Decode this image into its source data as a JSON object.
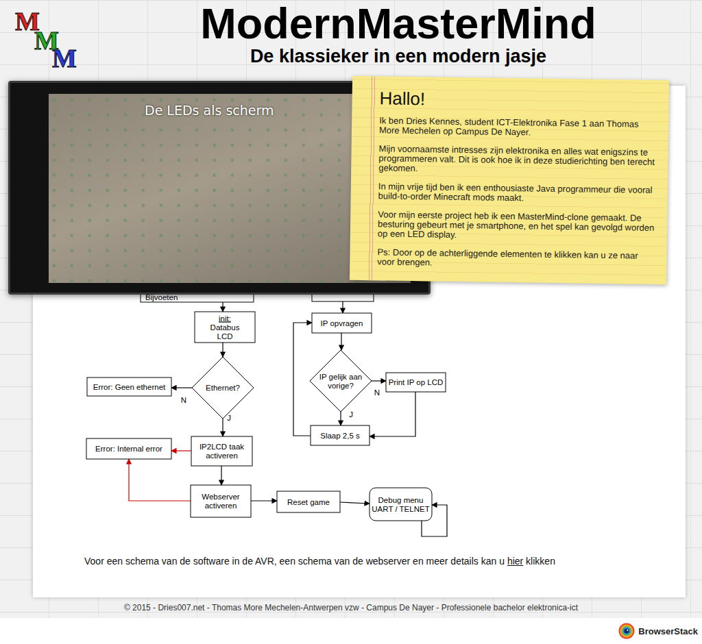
{
  "header": {
    "logo": [
      {
        "text": "M",
        "color": "#e0201c"
      },
      {
        "text": "M",
        "color": "#22b022"
      },
      {
        "text": "M",
        "color": "#2a3ad8"
      }
    ],
    "title": "ModernMasterMind",
    "subtitle": "De klassieker in een modern jasje"
  },
  "slideshow": {
    "caption": "De LEDs als scherm"
  },
  "note": {
    "title": "Hallo!",
    "paragraphs": [
      "Ik ben Dries Kennes, student ICT-Elektronika Fase 1 aan Thomas More Mechelen op Campus De Nayer.",
      "Mijn voornaamste intresses zijn elektronika en alles wat enigszins te programmeren valt. Dit is ook hoe ik in deze studierichting ben terecht gekomen.",
      "In mijn vrije tijd ben ik een enthousiaste Java programmeur die vooral build-to-order Minecraft mods maakt.",
      "Voor mijn eerste project heb ik een MasterMind-clone gemaakt. De besturing gebeurt met je smartphone, en het spel kan gevolgd worden op een LED display.",
      "Ps: Door op de achterliggende elementen te klikken kan u ze naar voor brengen."
    ]
  },
  "flowchart": {
    "nodes": [
      {
        "kind": "box",
        "lines": [
          "Bijvoeten"
        ],
        "underline_first": false
      },
      {
        "kind": "box",
        "lines": [],
        "underline_first": false
      },
      {
        "kind": "box",
        "lines": [
          "init:",
          "Databus",
          "LCD"
        ],
        "underline_first": true
      },
      {
        "kind": "diamond",
        "lines": [
          "Ethernet?"
        ],
        "underline_first": false
      },
      {
        "kind": "box",
        "lines": [
          "Error: Geen ethernet"
        ],
        "underline_first": false
      },
      {
        "kind": "box",
        "lines": [
          "IP2LCD taak",
          "activeren"
        ],
        "underline_first": false
      },
      {
        "kind": "box",
        "lines": [
          "Error: Internal error"
        ],
        "underline_first": false
      },
      {
        "kind": "box",
        "lines": [
          "Webserver",
          "activeren"
        ],
        "underline_first": false
      },
      {
        "kind": "box",
        "lines": [
          "Reset game"
        ],
        "underline_first": false
      },
      {
        "kind": "rounded",
        "lines": [
          "Debug menu",
          "UART / TELNET"
        ],
        "underline_first": false
      },
      {
        "kind": "box",
        "lines": [
          "IP opvragen"
        ],
        "underline_first": false
      },
      {
        "kind": "diamond",
        "lines": [
          "IP gelijk aan",
          "vorige?"
        ],
        "underline_first": false
      },
      {
        "kind": "box",
        "lines": [
          "Print IP op LCD"
        ],
        "underline_first": false
      },
      {
        "kind": "box",
        "lines": [
          "Slaap 2,5 s"
        ],
        "underline_first": false
      }
    ],
    "edges": [
      {
        "color": "#000000"
      },
      {
        "color": "#000000"
      },
      {
        "color": "#000000"
      },
      {
        "color": "#000000"
      },
      {
        "color": "#cc0000"
      },
      {
        "color": "#000000"
      },
      {
        "color": "#cc0000"
      },
      {
        "color": "#000000"
      },
      {
        "color": "#000000"
      },
      {
        "color": "#000000"
      },
      {
        "color": "#000000"
      },
      {
        "color": "#000000"
      },
      {
        "color": "#000000"
      },
      {
        "color": "#000000"
      },
      {
        "color": "#000000"
      },
      {
        "color": "#000000"
      }
    ],
    "labels": [
      "N",
      "J",
      "N",
      "J"
    ]
  },
  "more_info": {
    "before": "Voor een schema van de software in de AVR, een schema van de webserver en meer details kan u ",
    "link": "hier",
    "after": " klikken"
  },
  "footer": "© 2015 - Dries007.net - Thomas More Mechelen-Antwerpen vzw - Campus De Nayer - Professionele bachelor elektronica-ict",
  "badge": {
    "label": "BrowserStack"
  }
}
